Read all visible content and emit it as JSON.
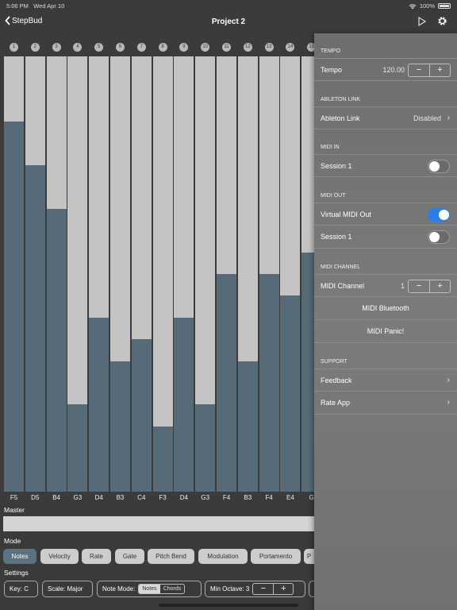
{
  "status": {
    "time": "5:06 PM",
    "date": "Wed Apr 10",
    "battery": "100%"
  },
  "nav": {
    "back_label": "StepBud",
    "title": "Project 2"
  },
  "steps": [
    {
      "num": "1",
      "note": "F5",
      "level": 0.85
    },
    {
      "num": "2",
      "note": "D5",
      "level": 0.75
    },
    {
      "num": "3",
      "note": "B4",
      "level": 0.65
    },
    {
      "num": "4",
      "note": "G3",
      "level": 0.2
    },
    {
      "num": "5",
      "note": "D4",
      "level": 0.4
    },
    {
      "num": "6",
      "note": "B3",
      "level": 0.3
    },
    {
      "num": "7",
      "note": "C4",
      "level": 0.35
    },
    {
      "num": "8",
      "note": "F3",
      "level": 0.15
    },
    {
      "num": "9",
      "note": "D4",
      "level": 0.4
    },
    {
      "num": "10",
      "note": "G3",
      "level": 0.2
    },
    {
      "num": "11",
      "note": "F4",
      "level": 0.5
    },
    {
      "num": "12",
      "note": "B3",
      "level": 0.3
    },
    {
      "num": "13",
      "note": "F4",
      "level": 0.5
    },
    {
      "num": "14",
      "note": "E4",
      "level": 0.45
    },
    {
      "num": "15",
      "note": "G",
      "level": 0.55
    }
  ],
  "master": {
    "label": "Master"
  },
  "mode": {
    "label": "Mode",
    "options": [
      "Notes",
      "Velocity",
      "Rate",
      "Gate",
      "Pitch Bend",
      "Modulation",
      "Portamento",
      "P"
    ],
    "selected": "Notes"
  },
  "settings": {
    "label": "Settings",
    "key": "Key: C",
    "scale": "Scale: Major",
    "note_mode": {
      "label": "Note Mode:",
      "options": [
        "Notes",
        "Chords"
      ],
      "selected": "Notes"
    },
    "min_octave": "Min Octave: 3",
    "minus": "−",
    "plus": "+"
  },
  "panel": {
    "tempo": {
      "header": "TEMPO",
      "label": "Tempo",
      "value": "120.00",
      "minus": "−",
      "plus": "+"
    },
    "ableton": {
      "header": "ABLETON LINK",
      "label": "Ableton Link",
      "value": "Disabled"
    },
    "midi_in": {
      "header": "MIDI IN",
      "session": "Session 1",
      "session_on": false
    },
    "midi_out": {
      "header": "MIDI OUT",
      "virtual": "Virtual MIDI Out",
      "virtual_on": true,
      "session": "Session 1",
      "session_on": false
    },
    "midi_channel": {
      "header": "MIDI CHANNEL",
      "label": "MIDI Channel",
      "value": "1",
      "minus": "−",
      "plus": "+",
      "bluetooth": "MIDI Bluetooth",
      "panic": "MIDI Panic!"
    },
    "support": {
      "header": "SUPPORT",
      "feedback": "Feedback",
      "rate": "Rate App"
    }
  },
  "colors": {
    "bar_fill": "#566a77",
    "bar_bg": "#c4c4c4",
    "accent_active": "#5b7280",
    "toggle_on": "#2b7ee6"
  }
}
